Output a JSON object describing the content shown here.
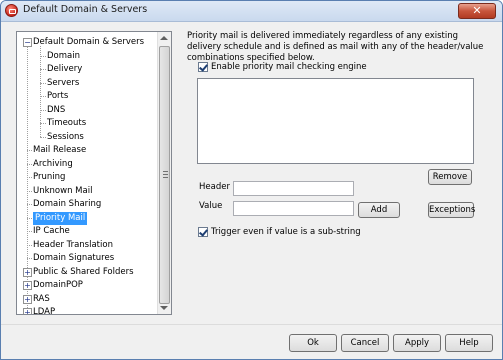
{
  "window": {
    "title": "Default Domain & Servers",
    "close_label": "✕"
  },
  "tree": {
    "items": [
      {
        "label": "Default Domain & Servers",
        "level": 0,
        "expander": "−"
      },
      {
        "label": "Domain",
        "level": 1
      },
      {
        "label": "Delivery",
        "level": 1
      },
      {
        "label": "Servers",
        "level": 1
      },
      {
        "label": "Ports",
        "level": 1
      },
      {
        "label": "DNS",
        "level": 1
      },
      {
        "label": "Timeouts",
        "level": 1
      },
      {
        "label": "Sessions",
        "level": 1
      },
      {
        "label": "Mail Release",
        "level": 0
      },
      {
        "label": "Archiving",
        "level": 0
      },
      {
        "label": "Pruning",
        "level": 0
      },
      {
        "label": "Unknown Mail",
        "level": 0
      },
      {
        "label": "Domain Sharing",
        "level": 0
      },
      {
        "label": "Priority Mail",
        "level": 0,
        "selected": true
      },
      {
        "label": "IP Cache",
        "level": 0
      },
      {
        "label": "Header Translation",
        "level": 0
      },
      {
        "label": "Domain Signatures",
        "level": 0
      },
      {
        "label": "Public & Shared Folders",
        "level": 0,
        "expander": "+"
      },
      {
        "label": "DomainPOP",
        "level": 0,
        "expander": "+"
      },
      {
        "label": "RAS",
        "level": 0,
        "expander": "+"
      },
      {
        "label": "LDAP",
        "level": 0,
        "expander": "+"
      }
    ]
  },
  "panel": {
    "description": "Priority mail is delivered immediately regardless of any existing delivery schedule and is defined as mail with any of the header/value combinations specified below.",
    "enable_label": "Enable priority mail checking engine",
    "enable_checked": true,
    "remove_label": "Remove",
    "header_label": "Header",
    "header_value": "",
    "value_label": "Value",
    "value_value": "",
    "add_label": "Add",
    "exceptions_label": "Exceptions",
    "substring_label": "Trigger even if value is a sub-string",
    "substring_checked": true
  },
  "footer": {
    "ok": "Ok",
    "cancel": "Cancel",
    "apply": "Apply",
    "help": "Help"
  }
}
